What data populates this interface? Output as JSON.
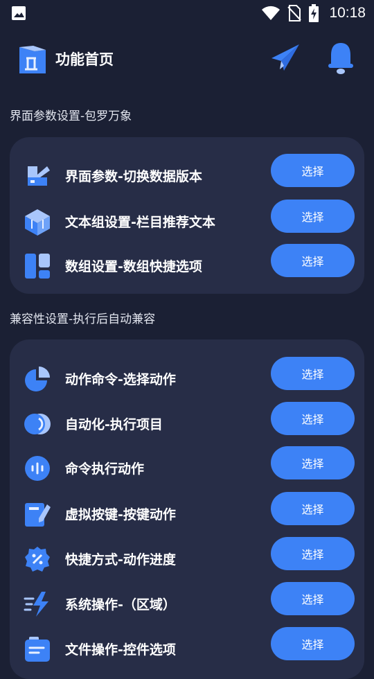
{
  "status_bar": {
    "time": "10:18",
    "icons": [
      "image-icon",
      "wifi-icon",
      "no-sim-icon",
      "battery-charging-icon"
    ]
  },
  "header": {
    "title": "功能首页",
    "icons": [
      "app-logo-icon",
      "send-icon",
      "bell-icon"
    ]
  },
  "sections": [
    {
      "title": "界面参数设置-包罗万象",
      "items": [
        {
          "label": "界面参数-切换数据版本",
          "icon": "ui-params-icon",
          "button": "选择"
        },
        {
          "label": "文本组设置-栏目推荐文本",
          "icon": "cube-icon",
          "button": "选择"
        },
        {
          "label": "数组设置-数组快捷选项",
          "icon": "layout-icon",
          "button": "选择"
        }
      ]
    },
    {
      "title": "兼容性设置-执行后自动兼容",
      "items": [
        {
          "label": "动作命令-选择动作",
          "icon": "pie-chart-icon",
          "button": "选择"
        },
        {
          "label": "自动化-执行项目",
          "icon": "toggle-circles-icon",
          "button": "选择"
        },
        {
          "label": "命令执行动作",
          "icon": "voice-icon",
          "button": "选择"
        },
        {
          "label": "虚拟按键-按键动作",
          "icon": "edit-key-icon",
          "button": "选择"
        },
        {
          "label": "快捷方式-动作进度",
          "icon": "percent-badge-icon",
          "button": "选择"
        },
        {
          "label": "系统操作-（区域）",
          "icon": "lightning-icon",
          "button": "选择"
        },
        {
          "label": "文件操作-控件选项",
          "icon": "folder-icon",
          "button": "选择"
        }
      ]
    }
  ],
  "colors": {
    "background": "#1b2034",
    "card": "#272d47",
    "accent": "#3d82f6",
    "icon_light": "#a9c6fb"
  }
}
